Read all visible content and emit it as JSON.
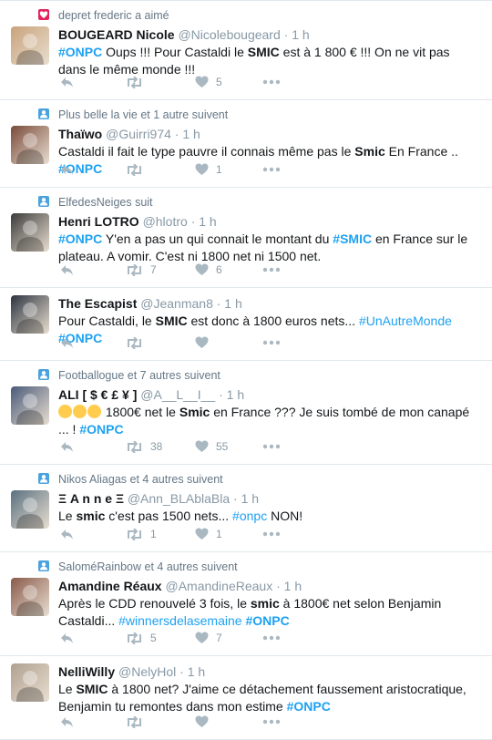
{
  "tweets": [
    {
      "context": "depret frederic a aimé",
      "context_icon": "heart-icon",
      "name": "BOUGEARD Nicole",
      "handle": "@Nicolebougeard",
      "time": "· 1 h",
      "text_parts": [
        {
          "tag": "#ONPC"
        },
        {
          "t": " Oups !!! Pour Castaldi le "
        },
        {
          "b": "SMIC"
        },
        {
          "t": " est à 1 800 € !!! On ne vit pas dans le même monde !!!"
        }
      ],
      "retweets": "",
      "likes": "5"
    },
    {
      "context": "Plus belle la vie et 1 autre suivent",
      "context_icon": "follow-icon",
      "name": "Thaïwo",
      "handle": "@Guirri974",
      "time": "· 1 h",
      "text_parts": [
        {
          "t": "Castaldi il fait le type pauvre il connais même pas le "
        },
        {
          "b": "Smic"
        },
        {
          "t": " En France .. "
        },
        {
          "tag": "#ONPC"
        }
      ],
      "retweets": "",
      "likes": "1"
    },
    {
      "context": "ElfedesNeiges suit",
      "context_icon": "follow-icon",
      "name": "Henri LOTRO",
      "handle": "@hlotro",
      "time": "· 1 h",
      "text_parts": [
        {
          "tag": "#ONPC"
        },
        {
          "t": " Y'en a pas un qui connait le montant du "
        },
        {
          "tag": "#SMIC"
        },
        {
          "t": " en France sur le plateau. A vomir. C'est ni 1800 net ni 1500 net."
        }
      ],
      "retweets": "7",
      "likes": "6"
    },
    {
      "context": "",
      "context_icon": "",
      "name": "The Escapist",
      "handle": "@Jeanman8",
      "time": "· 1 h",
      "text_parts": [
        {
          "t": "Pour Castaldi, le "
        },
        {
          "b": "SMIC"
        },
        {
          "t": " est donc à 1800 euros nets... "
        },
        {
          "tagl": "#UnAutreMonde"
        },
        {
          "t": " "
        },
        {
          "tag": "#ONPC"
        }
      ],
      "retweets": "",
      "likes": ""
    },
    {
      "context": "Footballogue et 7 autres suivent",
      "context_icon": "follow-icon",
      "name": "ALI [ $ € £ ¥ ]",
      "handle": "@A__L__I__",
      "time": "· 1 h",
      "emoji_prefix": true,
      "text_parts": [
        {
          "t": " 1800€ net le "
        },
        {
          "b": "Smic"
        },
        {
          "t": " en France ??? Je suis tombé de mon canapé ... ! "
        },
        {
          "tag": "#ONPC"
        }
      ],
      "retweets": "38",
      "likes": "55"
    },
    {
      "context": "Nikos Aliagas et 4 autres suivent",
      "context_icon": "follow-icon",
      "name": "Ξ A n n e Ξ",
      "handle": "@Ann_BLAblaBla",
      "time": "· 1 h",
      "text_parts": [
        {
          "t": "Le "
        },
        {
          "b": "smic"
        },
        {
          "t": " c'est pas 1500 nets... "
        },
        {
          "tagl": "#onpc"
        },
        {
          "t": " NON!"
        }
      ],
      "retweets": "1",
      "likes": "1"
    },
    {
      "context": "SaloméRainbow et 4 autres suivent",
      "context_icon": "follow-icon",
      "name": "Amandine Réaux",
      "handle": "@AmandineReaux",
      "time": "· 1 h",
      "text_parts": [
        {
          "t": "Après le CDD renouvelé 3 fois, le "
        },
        {
          "b": "smic"
        },
        {
          "t": " à 1800€ net selon Benjamin Castaldi... "
        },
        {
          "tagl": "#winnersdelasemaine"
        },
        {
          "t": " "
        },
        {
          "tag": "#ONPC"
        }
      ],
      "retweets": "5",
      "likes": "7"
    },
    {
      "context": "",
      "context_icon": "",
      "name": "NelliWilly",
      "handle": "@NelyHol",
      "time": "· 1 h",
      "text_parts": [
        {
          "t": "Le "
        },
        {
          "b": "SMIC"
        },
        {
          "t": " à 1800 net? J'aime ce détachement faussement aristocratique, Benjamin tu remontes dans mon estime "
        },
        {
          "tag": "#ONPC"
        }
      ],
      "retweets": "",
      "likes": ""
    }
  ],
  "icons": {
    "reply": "reply-icon",
    "retweet": "retweet-icon",
    "like": "heart-icon",
    "more": "more-icon"
  },
  "colors": {
    "hashtag": "#1da1f2",
    "muted": "#8899a6",
    "divider": "#e1e8ed",
    "like_context": "#e0245e",
    "follow_context": "#4aa3df"
  }
}
